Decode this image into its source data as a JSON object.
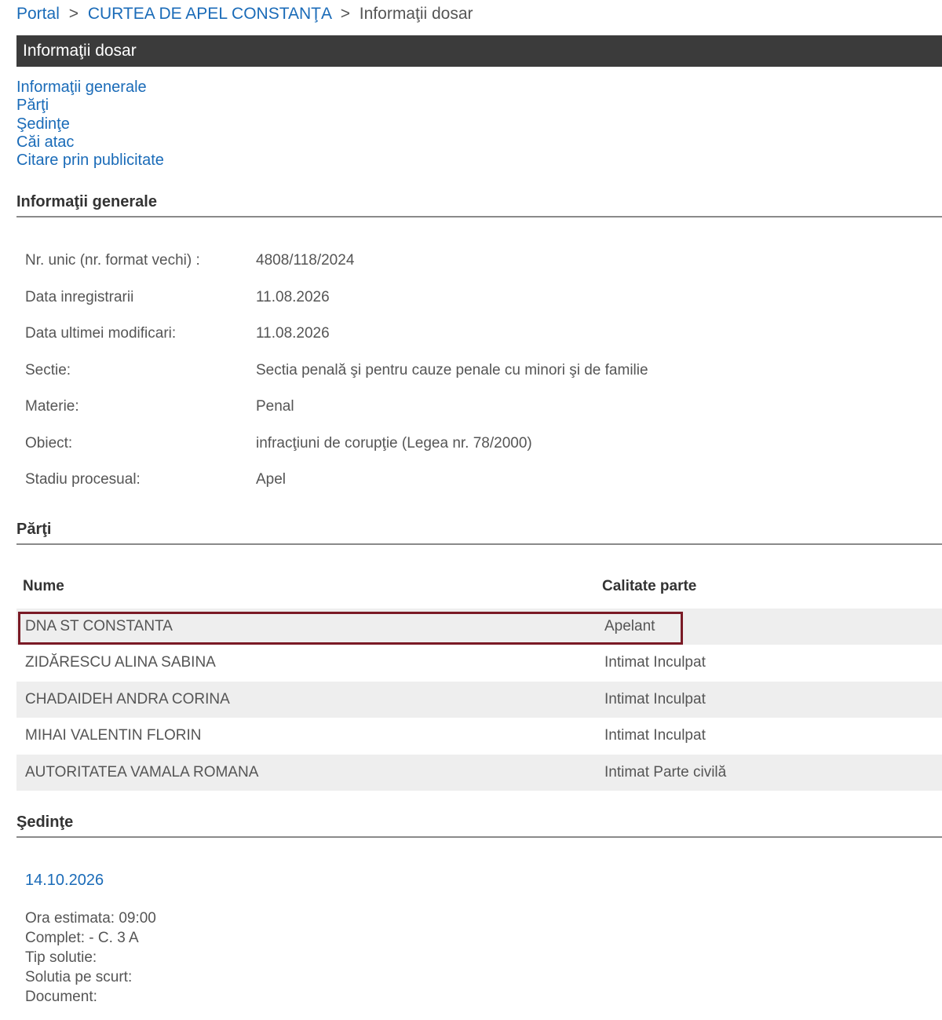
{
  "breadcrumb": {
    "items": [
      "Portal",
      "CURTEA DE APEL CONSTANŢA",
      "Informaţii dosar"
    ],
    "separator": ">"
  },
  "header": {
    "title": "Informaţii dosar"
  },
  "quick_nav": [
    "Informaţii generale",
    "Părţi",
    "Şedinţe",
    "Căi atac",
    "Citare prin publicitate"
  ],
  "general_info": {
    "title": "Informaţii generale",
    "rows": [
      {
        "label": "Nr. unic (nr. format vechi) :",
        "value": "4808/118/2024"
      },
      {
        "label": "Data inregistrarii",
        "value": "11.08.2026"
      },
      {
        "label": "Data ultimei modificari:",
        "value": "11.08.2026"
      },
      {
        "label": "Sectie:",
        "value": "Sectia penală şi pentru cauze penale cu minori şi de familie"
      },
      {
        "label": "Materie:",
        "value": "Penal"
      },
      {
        "label": "Obiect:",
        "value": "infracţiuni de corupţie (Legea nr. 78/2000)"
      },
      {
        "label": "Stadiu procesual:",
        "value": "Apel"
      }
    ]
  },
  "parties": {
    "title": "Părţi",
    "headers": {
      "name": "Nume",
      "role": "Calitate parte"
    },
    "rows": [
      {
        "name": "DNA ST CONSTANTA",
        "role": "Apelant"
      },
      {
        "name": "ZIDĂRESCU ALINA SABINA",
        "role": "Intimat Inculpat"
      },
      {
        "name": "CHADAIDEH ANDRA CORINA",
        "role": "Intimat Inculpat"
      },
      {
        "name": "MIHAI VALENTIN FLORIN",
        "role": "Intimat Inculpat"
      },
      {
        "name": "AUTORITATEA VAMALA ROMANA",
        "role": "Intimat Parte civilă"
      }
    ]
  },
  "hearings": {
    "title": "Şedinţe",
    "date": "14.10.2026",
    "details": [
      "Ora estimata: 09:00",
      "Complet: - C. 3 A",
      "Tip solutie:",
      "Solutia pe scurt:",
      "Document:"
    ]
  },
  "colors": {
    "link": "#1a6bb8",
    "header_bar": "#3b3b3b",
    "highlight_border": "#7a1a25",
    "row_shade": "#eeeeee"
  }
}
